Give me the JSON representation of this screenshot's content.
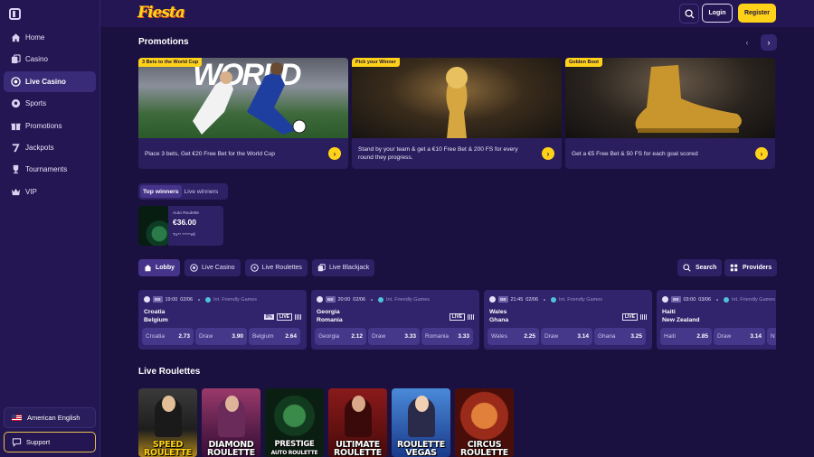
{
  "sidebar": {
    "items": [
      {
        "label": "Home",
        "icon": "home-icon"
      },
      {
        "label": "Casino",
        "icon": "casino-icon"
      },
      {
        "label": "Live Casino",
        "icon": "live-casino-icon",
        "active": true
      },
      {
        "label": "Sports",
        "icon": "sports-icon"
      },
      {
        "label": "Promotions",
        "icon": "promotions-icon"
      },
      {
        "label": "Jackpots",
        "icon": "jackpots-icon"
      },
      {
        "label": "Tournaments",
        "icon": "trophy-icon"
      },
      {
        "label": "VIP",
        "icon": "crown-icon"
      }
    ],
    "language": "American English",
    "support": "Support"
  },
  "header": {
    "logo": "Fiesta",
    "login": "Login",
    "register": "Register"
  },
  "promotions": {
    "title": "Promotions",
    "cards": [
      {
        "tag": "3 Bets to the World Cup",
        "text": "Place 3 bets, Get €20 Free Bet for the World Cup",
        "image_text": "WORLD"
      },
      {
        "tag": "Pick your Winner",
        "text": "Stand by your team & get a €10 Free Bet & 200 FS for every round they progress."
      },
      {
        "tag": "Golden Boot",
        "text": "Get a €5 Free Bet & 50 FS for each goal scored"
      }
    ]
  },
  "winners": {
    "tabs": [
      "Top winners",
      "Live winners"
    ],
    "items": [
      {
        "game": "Auto Roulette",
        "amount": "€36.00",
        "user": "Tu** *****ell"
      }
    ]
  },
  "lobby": {
    "tabs": [
      "Lobby",
      "Live Casino",
      "Live Roulettes",
      "Live Blackjack"
    ],
    "search": "Search",
    "providers": "Providers"
  },
  "matches": [
    {
      "time": "19:00",
      "date": "02/06",
      "competition": "Int. Friendly Games",
      "home": "Croatia",
      "away": "Belgium",
      "badge_pct": "0%",
      "live": "LIVE",
      "odds": [
        {
          "name": "Croatia",
          "value": "2.73"
        },
        {
          "name": "Draw",
          "value": "3.90"
        },
        {
          "name": "Belgium",
          "value": "2.64"
        }
      ]
    },
    {
      "time": "20:00",
      "date": "02/06",
      "competition": "Int. Friendly Games",
      "home": "Georgia",
      "away": "Romania",
      "live": "LIVE",
      "odds": [
        {
          "name": "Georgia",
          "value": "2.12"
        },
        {
          "name": "Draw",
          "value": "3.33"
        },
        {
          "name": "Romania",
          "value": "3.33"
        }
      ]
    },
    {
      "time": "21:45",
      "date": "02/06",
      "competition": "Int. Friendly Games",
      "home": "Wales",
      "away": "Ghana",
      "live": "LIVE",
      "odds": [
        {
          "name": "Wales",
          "value": "2.25"
        },
        {
          "name": "Draw",
          "value": "3.14"
        },
        {
          "name": "Ghana",
          "value": "3.25"
        }
      ]
    },
    {
      "time": "03:00",
      "date": "03/06",
      "competition": "Int. Friendly Games",
      "home": "Haiti",
      "away": "New Zealand",
      "odds": [
        {
          "name": "Haiti",
          "value": "2.85"
        },
        {
          "name": "Draw",
          "value": "3.14"
        },
        {
          "name": "N",
          "value": ""
        }
      ]
    }
  ],
  "live_roulettes": {
    "title": "Live Roulettes",
    "games": [
      {
        "line1": "SPEED",
        "line2": "ROULETTE"
      },
      {
        "line1": "DIAMOND",
        "line2": "ROULETTE"
      },
      {
        "line1": "PRESTIGE",
        "line2": "AUTO ROULETTE"
      },
      {
        "line1": "ULTIMATE",
        "line2": "ROULETTE"
      },
      {
        "line1": "ROULETTE",
        "line2": "VEGAS"
      },
      {
        "line1": "CIRCUS",
        "line2": "ROULETTE"
      }
    ]
  },
  "colors": {
    "accent": "#ffd21a",
    "bg": "#1b1140",
    "panel": "#2e2166"
  }
}
